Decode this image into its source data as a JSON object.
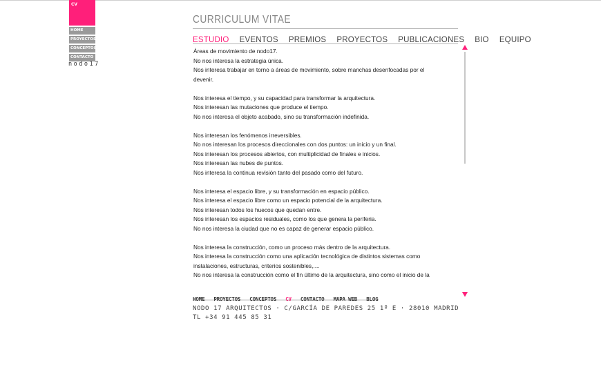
{
  "logo": {
    "label": "CV"
  },
  "side_menu": [
    {
      "label": "HOME"
    },
    {
      "label": "PROYECTOS"
    },
    {
      "label": "CONCEPTOS"
    },
    {
      "label": "CONTACTO"
    }
  ],
  "brand": "nodo17",
  "header": {
    "title": "CURRICULUM VITAE",
    "tabs": [
      {
        "label": "ESTUDIO",
        "active": true
      },
      {
        "label": "EVENTOS"
      },
      {
        "label": "PREMIOS"
      },
      {
        "label": "PROYECTOS"
      },
      {
        "label": "PUBLICACIONES"
      },
      {
        "label": "BIO"
      },
      {
        "label": "EQUIPO"
      }
    ]
  },
  "content": {
    "lines": [
      "Áreas de movimiento de nodo17.",
      "No nos interesa la estrategia única.",
      "Nos interesa trabajar en torno a áreas de movimiento, sobre manchas desenfocadas por el",
      "devenir.",
      "",
      "Nos interesa el tiempo, y su capacidad para transformar la arquitectura.",
      "Nos interesan las mutaciones que produce el tiempo.",
      "No nos interesa el objeto acabado, sino su transformación indefinida.",
      "",
      "Nos interesan los fenómenos irreversibles.",
      "No nos interesan los procesos direccionales con dos puntos: un inicio y un final.",
      "Nos interesan los procesos abiertos, con multiplicidad de finales e inicios.",
      "Nos interesan las nubes de puntos.",
      "Nos interesa la continua revisión tanto del pasado como del futuro.",
      "",
      "Nos interesa el espacio libre, y su transformación en espacio público.",
      "Nos interesa el espacio libre como un espacio potencial de la arquitectura.",
      "Nos interesan todos los huecos que quedan entre.",
      "Nos interesan los espacios residuales, como los que genera la periferia.",
      "No nos interesa la ciudad que no es capaz de generar espacio público.",
      "",
      "Nos interesa la construcción, como un proceso más dentro de la arquitectura.",
      "Nos interesa la construcción como una aplicación tecnológica de distintos sistemas como",
      "instalaciones, estructuras, criterios sostenibles,....",
      "No nos interesa la construcción como el fin último de la arquitectura, sino como el inicio de la"
    ]
  },
  "footer": {
    "nav": [
      {
        "label": "HOME"
      },
      {
        "label": "PROYECTOS"
      },
      {
        "label": "CONCEPTOS"
      },
      {
        "label": "CV",
        "active": true
      },
      {
        "label": "CONTACTO"
      },
      {
        "label": "MAPA WEB"
      },
      {
        "label": "BLOG"
      }
    ],
    "address_line1": "NODO 17 ARQUITECTOS · C/GARCÍA DE PAREDES 25 1º E · 28010 MADRID",
    "address_line2": "TL +34 91 445 85 31"
  },
  "colors": {
    "accent": "#ff1f7a",
    "menu_gray": "#9a9a9a",
    "rule": "#b5b5b5"
  }
}
